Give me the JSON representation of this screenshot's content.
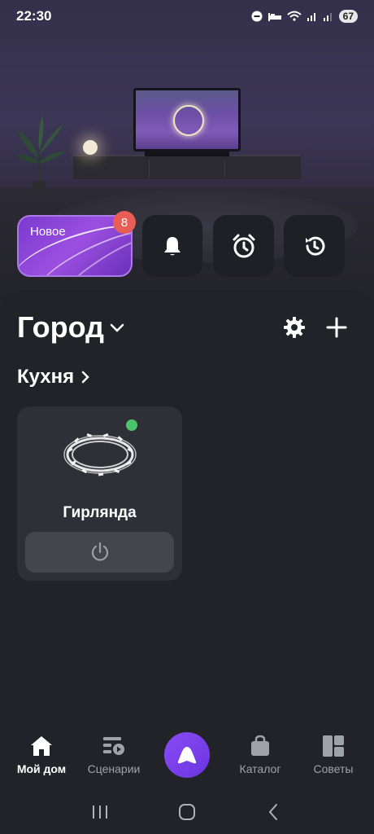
{
  "status_bar": {
    "time": "22:30",
    "battery": "67"
  },
  "quick_tiles": {
    "new_label": "Новое",
    "new_badge": "8",
    "icons": [
      "bell-icon",
      "alarm-clock-icon",
      "history-icon"
    ]
  },
  "home": {
    "title": "Город",
    "room": "Кухня"
  },
  "device": {
    "name": "Гирлянда",
    "online": true,
    "icon": "garland-icon"
  },
  "bottom_nav": {
    "items": [
      {
        "label": "Мой дом",
        "icon": "home-icon",
        "active": true
      },
      {
        "label": "Сценарии",
        "icon": "scenarios-icon",
        "active": false
      },
      {
        "label": "Каталог",
        "icon": "bag-icon",
        "active": false
      },
      {
        "label": "Советы",
        "icon": "tips-icon",
        "active": false
      }
    ],
    "center": "alice-icon"
  },
  "colors": {
    "accent": "#7a3ad0",
    "online": "#4cc46a",
    "badge": "#e85d55",
    "background": "#222329"
  }
}
